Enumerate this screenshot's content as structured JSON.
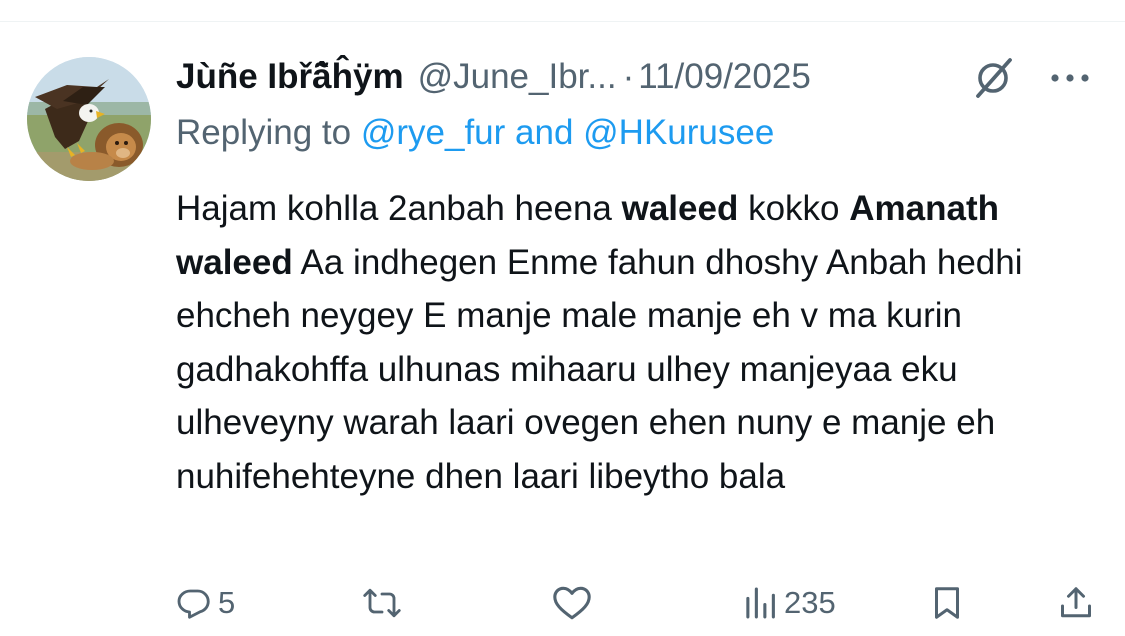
{
  "tweet": {
    "author": {
      "display_name": "Jùñe Ibřã̂ĥÿm",
      "handle": "@June_Ibr...",
      "avatar": "eagle-and-lion-photo"
    },
    "separator": "·",
    "date": "11/09/2025",
    "reply": {
      "prefix": "Replying to ",
      "mention_1": "@rye_fur",
      "and": " and ",
      "mention_2": "@HKurusee"
    },
    "text_segments": [
      {
        "text": "Hajam kohlla 2anbah heena ",
        "bold": false
      },
      {
        "text": "waleed",
        "bold": true
      },
      {
        "text": " kokko ",
        "bold": false
      },
      {
        "text": "Amanath waleed",
        "bold": true
      },
      {
        "text": " Aa indhegen Enme fahun dhoshy Anbah hedhi ehcheh neygey E manje male manje eh v ma kurin gadhakohffa ulhunas mihaaru ulhey manjeyaa eku ulheveyny warah laari ovegen ehen nuny e manje eh nuhifehehteyne dhen laari libeytho bala",
        "bold": false
      }
    ],
    "actions": {
      "reply_count": "5",
      "repost_count": "",
      "like_count": "",
      "views_count": "235"
    },
    "icons": {
      "grok": "grok-icon",
      "more": "more-icon",
      "reply": "reply-icon",
      "repost": "repost-icon",
      "like": "like-icon",
      "views": "views-icon",
      "bookmark": "bookmark-icon",
      "share": "share-icon"
    },
    "colors": {
      "text": "#0f1419",
      "secondary": "#536471",
      "link": "#1d9bf0",
      "divider": "#eff3f4"
    }
  }
}
